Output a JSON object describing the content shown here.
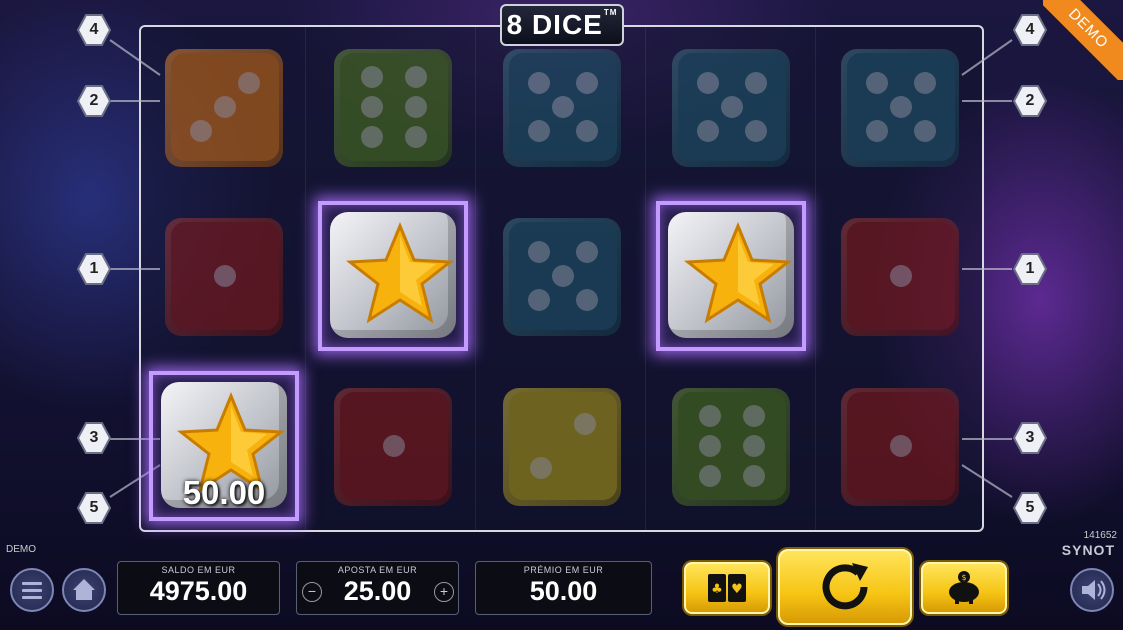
{
  "game": {
    "title": "8 DICE",
    "trademark": "TM",
    "demo_ribbon": "DEMO",
    "demo_label": "DEMO"
  },
  "paylines": {
    "left": [
      "4",
      "2",
      "1",
      "3",
      "5"
    ],
    "right": [
      "4",
      "2",
      "1",
      "3",
      "5"
    ]
  },
  "grid": {
    "rows": [
      [
        {
          "symbol": "die-3",
          "color": "#d9730f"
        },
        {
          "symbol": "die-6",
          "color": "#4f7a1a"
        },
        {
          "symbol": "die-5",
          "color": "#1f5b6e"
        },
        {
          "symbol": "die-5",
          "color": "#1f5b6e"
        },
        {
          "symbol": "die-5",
          "color": "#1f5b6e"
        }
      ],
      [
        {
          "symbol": "die-1",
          "color": "#8e1a17"
        },
        {
          "symbol": "star",
          "color": "#c9ccd3",
          "winning": true
        },
        {
          "symbol": "die-5",
          "color": "#1f5b6e"
        },
        {
          "symbol": "star",
          "color": "#c9ccd3",
          "winning": true
        },
        {
          "symbol": "die-1",
          "color": "#8e1a17"
        }
      ],
      [
        {
          "symbol": "star",
          "color": "#c9ccd3",
          "winning": true
        },
        {
          "symbol": "die-1",
          "color": "#8e1a17"
        },
        {
          "symbol": "die-2",
          "color": "#b9a514"
        },
        {
          "symbol": "die-6",
          "color": "#4f7a1a"
        },
        {
          "symbol": "die-1",
          "color": "#8e1a17"
        }
      ]
    ]
  },
  "win_display": "50.00",
  "footer": {
    "balance": {
      "label": "SALDO EM EUR",
      "value": "4975.00"
    },
    "bet": {
      "label": "APOSTA EM EUR",
      "value": "25.00"
    },
    "prize": {
      "label": "PRÉMIO EM EUR",
      "value": "50.00"
    },
    "build": "141652",
    "brand": "SYNOT"
  },
  "colors": {
    "accent_yellow": "#f6c414",
    "win_glow": "#c49cff",
    "ribbon": "#f08a1e"
  },
  "icons": [
    "menu-icon",
    "home-icon",
    "minus-icon",
    "plus-icon",
    "cards-icon",
    "spin-icon",
    "piggy-bank-icon",
    "speaker-icon"
  ]
}
